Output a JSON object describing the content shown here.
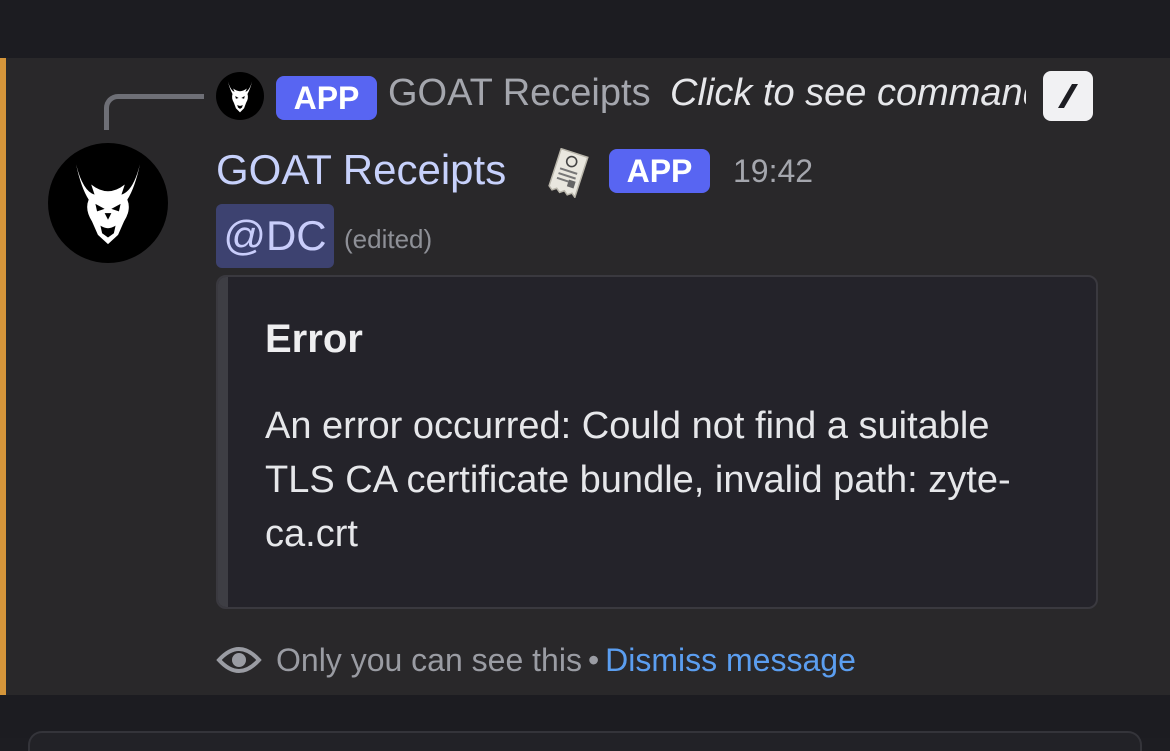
{
  "reply": {
    "badge": "APP",
    "name": "GOAT Receipts",
    "command_hint": "Click to see command"
  },
  "message": {
    "author": "GOAT Receipts",
    "badge": "APP",
    "timestamp": "19:42",
    "mention": "@DC",
    "edited": "(edited)"
  },
  "embed": {
    "title": "Error",
    "description": "An error occurred: Could not find a suitable TLS CA certificate bundle, invalid path: zyte-ca.crt"
  },
  "footer": {
    "visibility_text": "Only you can see this",
    "separator": "•",
    "dismiss_label": "Dismiss message"
  },
  "colors": {
    "accent_bar": "#d4953a",
    "app_badge": "#5865f2",
    "link": "#5b9ef0",
    "mention_bg": "#3d4270"
  },
  "icons": {
    "reply_avatar": "goat-logo-icon",
    "slash_command": "slash-command-icon",
    "author_decoration": "receipt-icon",
    "visibility": "eye-icon"
  }
}
